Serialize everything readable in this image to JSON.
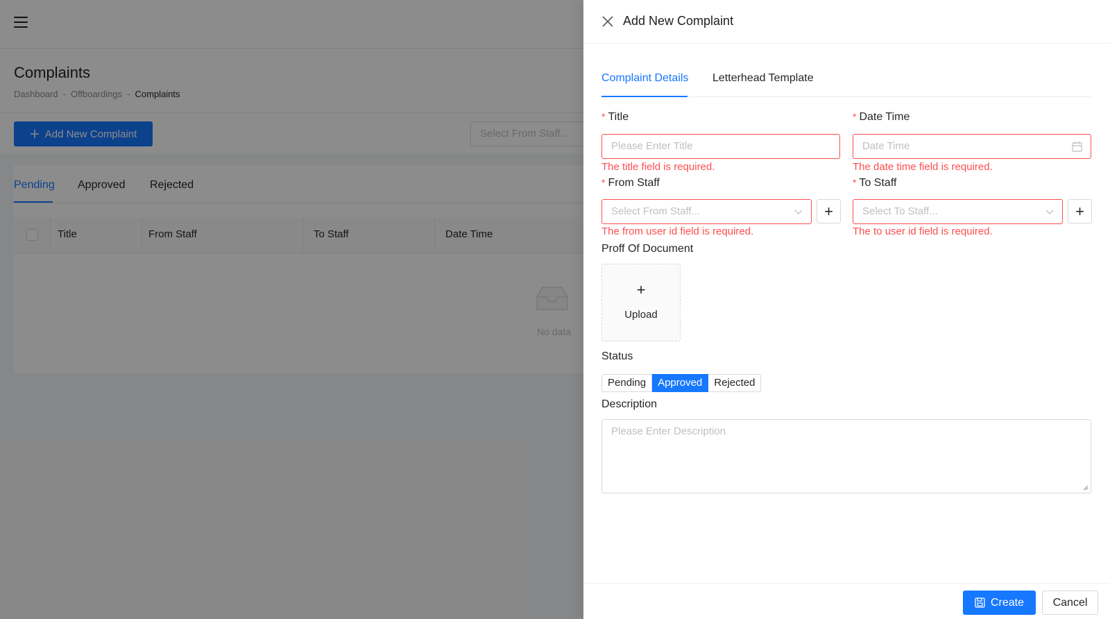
{
  "background": {
    "page_title": "Complaints",
    "breadcrumb": [
      "Dashboard",
      "Offboardings",
      "Complaints"
    ],
    "breadcrumb_separator": "-",
    "add_button_label": "Add New Complaint",
    "from_staff_filter_placeholder": "Select From Staff...",
    "tabs": [
      "Pending",
      "Approved",
      "Rejected"
    ],
    "active_tab": "Pending",
    "table_columns": [
      "Title",
      "From Staff",
      "To Staff",
      "Date Time"
    ],
    "empty_text": "No data"
  },
  "drawer": {
    "title": "Add New Complaint",
    "tabs": [
      "Complaint Details",
      "Letterhead Template"
    ],
    "active_tab": "Complaint Details",
    "fields": {
      "title": {
        "label": "Title",
        "required_mark": "*",
        "placeholder": "Please Enter Title",
        "error": "The title field is required."
      },
      "date_time": {
        "label": "Date Time",
        "required_mark": "*",
        "placeholder": "Date Time",
        "error": "The date time field is required."
      },
      "from_staff": {
        "label": "From Staff",
        "required_mark": "*",
        "placeholder": "Select From Staff...",
        "error": "The from user id field is required."
      },
      "to_staff": {
        "label": "To Staff",
        "required_mark": "*",
        "placeholder": "Select To Staff...",
        "error": "The to user id field is required."
      },
      "proof_document": {
        "label": "Proff Of Document",
        "upload_plus": "+",
        "upload_text": "Upload"
      },
      "status": {
        "label": "Status",
        "options": [
          "Pending",
          "Approved",
          "Rejected"
        ],
        "selected": "Approved"
      },
      "description": {
        "label": "Description",
        "placeholder": "Please Enter Description"
      }
    },
    "add_staff_button": "+",
    "footer": {
      "create_label": "Create",
      "cancel_label": "Cancel"
    }
  },
  "colors": {
    "primary": "#1677ff",
    "error": "#ff4d4f",
    "mask": "rgba(0,0,0,0.45)"
  },
  "icons": [
    "menu-icon",
    "plus-icon",
    "inbox-empty-icon",
    "close-icon",
    "calendar-icon",
    "chevron-down-icon",
    "save-icon"
  ]
}
